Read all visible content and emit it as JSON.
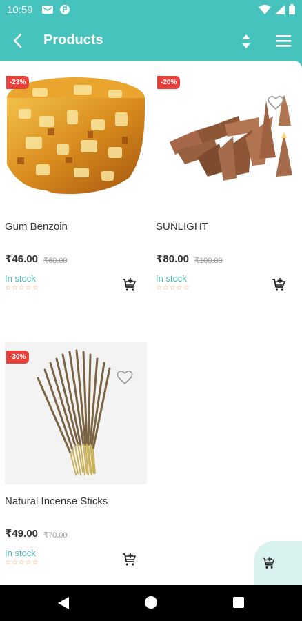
{
  "status_bar": {
    "time": "10:59"
  },
  "app_bar": {
    "title": "Products"
  },
  "products": [
    {
      "name": "Gum Benzoin",
      "price": "₹46.00",
      "old_price": "₹60.00",
      "discount": "-23%",
      "stock": "In stock",
      "stars": "☆☆☆☆☆"
    },
    {
      "name": "SUNLIGHT",
      "price": "₹80.00",
      "old_price": "₹100.00",
      "discount": "-20%",
      "stock": "In stock",
      "stars": "☆☆☆☆☆"
    },
    {
      "name": "Natural Incense Sticks",
      "price": "₹49.00",
      "old_price": "₹70.00",
      "discount": "-30%",
      "stock": "In stock",
      "stars": "☆☆☆☆☆"
    }
  ],
  "colors": {
    "accent": "#46c3bd",
    "discount": "#e8403a",
    "stock": "#49b7b0",
    "stars": "#f0a04b"
  },
  "icons": [
    "back-arrow-icon",
    "sort-icon",
    "menu-icon",
    "heart-icon",
    "add-to-cart-icon",
    "cart-icon"
  ]
}
